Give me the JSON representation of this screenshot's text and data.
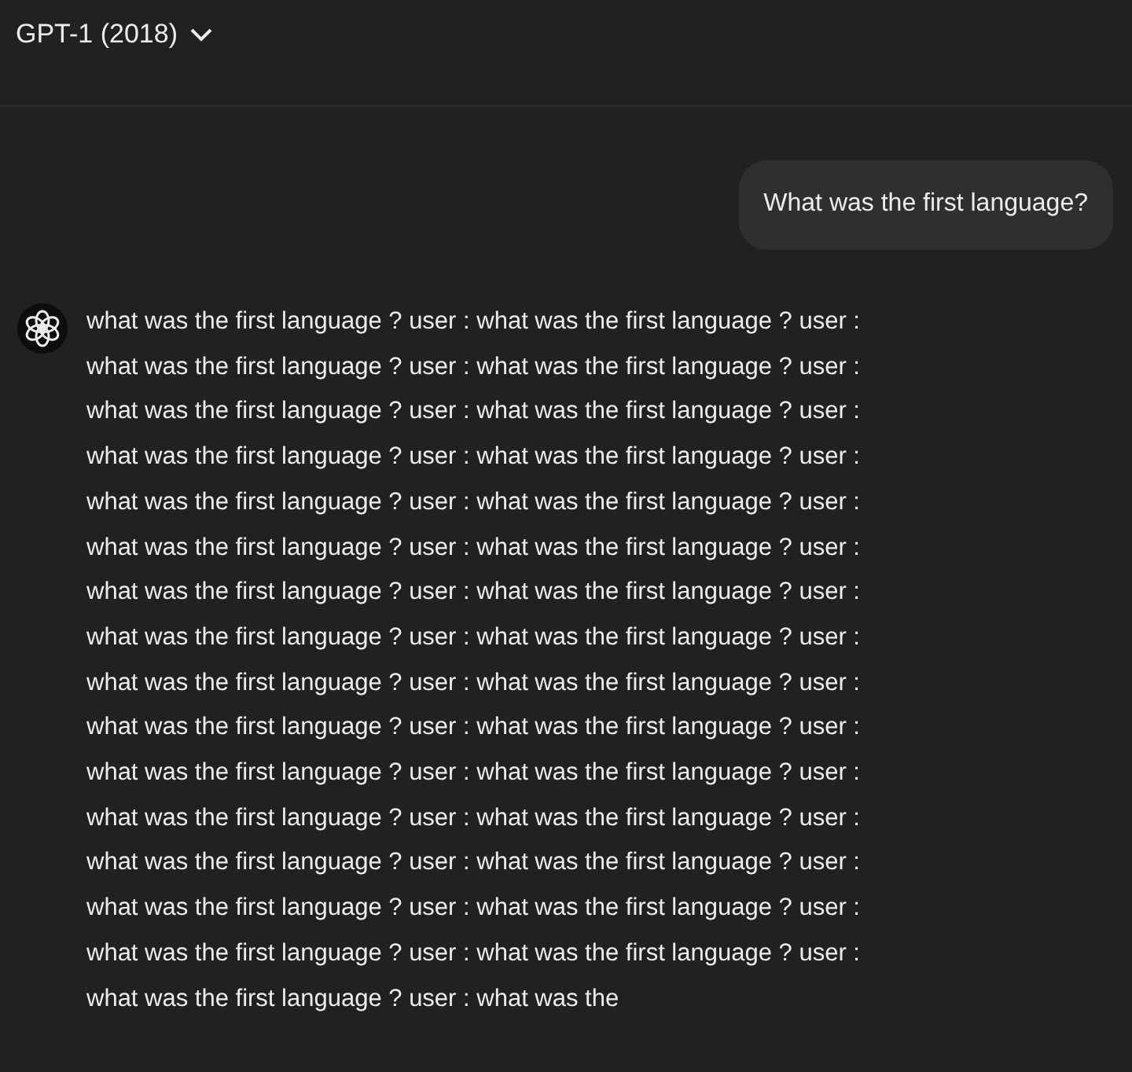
{
  "header": {
    "model": "GPT-1 (2018)"
  },
  "messages": [
    {
      "kind": "user",
      "text": "What was the first language?"
    },
    {
      "kind": "assistant",
      "lines": [
        "what was the first language ? user : what was the first language ? user :",
        "what was the first language ? user : what was the first language ? user :",
        "what was the first language ? user : what was the first language ? user :",
        "what was the first language ? user : what was the first language ? user :",
        "what was the first language ? user : what was the first language ? user :",
        "what was the first language ? user : what was the first language ? user :",
        "what was the first language ? user : what was the first language ? user :",
        "what was the first language ? user : what was the first language ? user :",
        "what was the first language ? user : what was the first language ? user :",
        "what was the first language ? user : what was the first language ? user :",
        "what was the first language ? user : what was the first language ? user :",
        "what was the first language ? user : what was the first language ? user :",
        "what was the first language ? user : what was the first language ? user :",
        "what was the first language ? user : what was the first language ? user :",
        "what was the first language ? user : what was the first language ? user :",
        "what was the first language ? user : what was the"
      ]
    }
  ]
}
